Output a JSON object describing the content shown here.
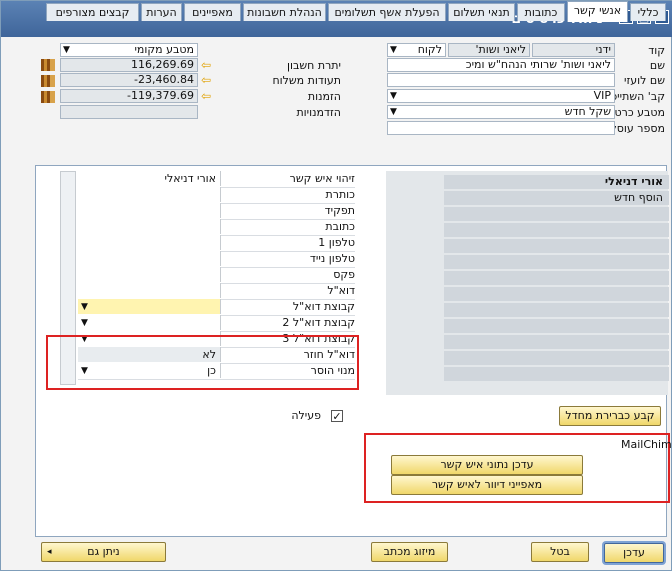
{
  "window": {
    "title": "ניהול כרטיסים"
  },
  "header": {
    "labels": {
      "code": "קוד",
      "name": "שם",
      "foreign_name": "שם לועזי",
      "group": "קב' השתייכות",
      "currency": "מטבע כרטיס",
      "tax_id": "מספר עוסק מורשה",
      "balance": "יתרת חשבון",
      "deliveries": "תעודות משלוח",
      "orders": "הזמנות",
      "opportunities": "הזדמנויות"
    },
    "values": {
      "code": "ידני",
      "code_type": "לקוח",
      "code_value": "ליאני ושות'",
      "name": "ליאני ושות' שרותי הנהח\"ש ומיכ",
      "foreign_name": "",
      "group": "VIP",
      "currency": "שקל חדש",
      "tax_id": "",
      "currency_local": "מטבע מקומי",
      "balance": "116,269.69",
      "deliveries": "-23,460.84",
      "orders": "-119,379.69",
      "opportunities": ""
    }
  },
  "tabs": [
    "כללי",
    "אנשי קשר",
    "כתובות",
    "תנאי תשלום",
    "הפעלת אשף תשלומים",
    "הנהלת חשבונות",
    "מאפיינים",
    "הערות",
    "קבצים מצורפים"
  ],
  "contacts": {
    "list": [
      "אורי דניאלי",
      "הוסף חדש"
    ],
    "fields": [
      {
        "label": "זיהוי איש קשר",
        "value": "אורי דניאלי"
      },
      {
        "label": "כותרת",
        "value": ""
      },
      {
        "label": "תפקיד",
        "value": ""
      },
      {
        "label": "כתובת",
        "value": ""
      },
      {
        "label": "טלפון 1",
        "value": ""
      },
      {
        "label": "טלפון נייד",
        "value": ""
      },
      {
        "label": "פקס",
        "value": ""
      },
      {
        "label": "דוא\"ל",
        "value": ""
      },
      {
        "label": "קבוצת דוא\"ל",
        "value": ""
      },
      {
        "label": "קבוצת דוא\"ל 2",
        "value": ""
      },
      {
        "label": "קבוצת דוא\"ל 3",
        "value": ""
      },
      {
        "label": "דוא\"ל חוזר",
        "value": "לא"
      },
      {
        "label": "מנוי הוסר",
        "value": "כן"
      }
    ],
    "active_label": "פעילה",
    "set_default_button": "קבע כברירת מחדל",
    "mailchimp_title": "MailChimp",
    "update_contact_button": "עדכן נתוני איש קשר",
    "mail_attributes_button": "מאפייני דיוור לאיש קשר"
  },
  "footer": {
    "update": "עדכן",
    "cancel": "בטל",
    "mailmerge": "מיזוג מכתב",
    "related": "ניתן גם"
  }
}
